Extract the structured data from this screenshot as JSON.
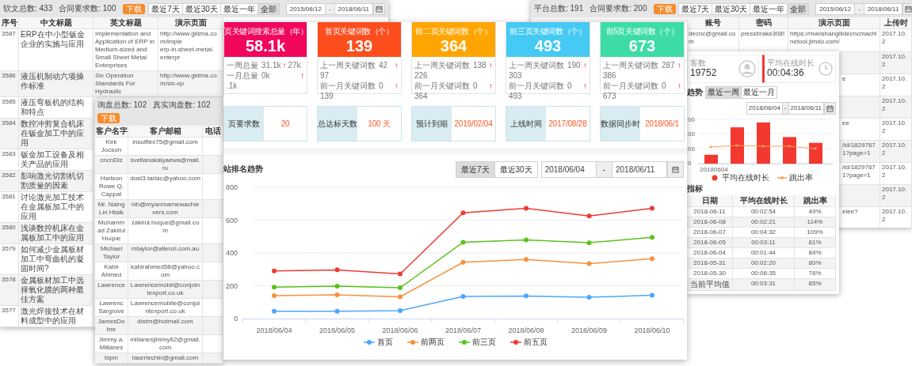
{
  "left_window": {
    "stats": [
      "软文总数: 433",
      "合同要求数: 100"
    ],
    "download": "下载",
    "ranges": [
      {
        "label": "最近7天",
        "selected": false
      },
      {
        "label": "最近30天",
        "selected": false
      },
      {
        "label": "最近一年",
        "selected": false
      },
      {
        "label": "全部",
        "selected": true
      }
    ],
    "date_from": "2015/06/12",
    "date_sep": "-",
    "date_to": "2018/06/11",
    "columns": [
      "序号",
      "中文标题",
      "英文标题",
      "演示页面"
    ],
    "rows": [
      {
        "id": "3587",
        "title_cn": "ERP在中小型钣金企业的实施与应用",
        "title_en": "Implementation and Application of ERP in Medium-sized and Small Sheet Metal Enterprises",
        "url_lines": [
          "http://www.gldma.com/imple",
          "erp-in-sheet-metal-enterpr"
        ]
      },
      {
        "id": "3586",
        "title_cn": "液压机制动六项操作标准",
        "title_en": "Six Operation Standards For Hydraulic",
        "url_lines": [
          "http://www.gldma.com/six-op"
        ]
      },
      {
        "id": "3585",
        "title_cn": "液压弯板机的结构和特点"
      },
      {
        "id": "3584",
        "title_cn": "数控冲剪复合机床在钣金加工中的应用"
      },
      {
        "id": "3583",
        "title_cn": "钣金加工设备及相关产品的应用"
      },
      {
        "id": "3582",
        "title_cn": "影响激光切割机切割质量的因素"
      },
      {
        "id": "3581",
        "title_cn": "讨论激光加工技术在金属板加工中的应用"
      },
      {
        "id": "3580",
        "title_cn": "浅谈数控机床在金属板加工中的应用"
      },
      {
        "id": "3579",
        "title_cn": "如何减少金属板材加工中弯曲机的凝固时间?"
      },
      {
        "id": "3578",
        "title_cn": "金属板材加工中选择氧化膜的两种最佳方案"
      },
      {
        "id": "3577",
        "title_cn": "激光焊接技术在材料成型中的应用"
      }
    ]
  },
  "customer_window": {
    "stats": [
      "询盘总数: 102",
      "真实询盘数: 102"
    ],
    "download": "下载",
    "columns": [
      "客户名字",
      "客户邮箱",
      "电话"
    ],
    "rows": [
      {
        "name": "Kirk Jocson",
        "email": "insulflex75@gmail.com"
      },
      {
        "name": "cncnDiz",
        "email": "svetlanakalyaewa@mail.ru"
      },
      {
        "name": "Harlson Rowe Q. Cappal",
        "email": "dost3.tarlac@yahoo.com"
      },
      {
        "name": "Mr. Naing Lin Htaik",
        "email": "nlh@myanmarnewachievers.com"
      },
      {
        "name": "Muhammad Zakirul Huque",
        "email": "zakirul.huque@gmail.com"
      },
      {
        "name": "Michael Taylor",
        "email": "mtaylor@allenzi.com.au"
      },
      {
        "name": "Kabir Ahmed",
        "email": "kabirahmed58@yahoo.com"
      },
      {
        "name": "Lawrence",
        "email": "Lawrencemobil@conjointexport.co.uk"
      },
      {
        "name": "Lawrenc Sargrove",
        "email": "Lawrencemobile@conjointexport.co.uk"
      },
      {
        "name": "JamesDobre",
        "email": "distm@hotmail.com"
      },
      {
        "name": "Jimmy a. Millanes",
        "email": "millanesjimmy62@gmail.com"
      },
      {
        "name": "bipin",
        "email": "lasertechin@gmail.com"
      }
    ]
  },
  "right_window": {
    "stats": [
      "平台总数: 191",
      "合同要求数: 200"
    ],
    "download": "下载",
    "ranges": [
      {
        "label": "最近7天",
        "selected": false
      },
      {
        "label": "最近30天",
        "selected": false
      },
      {
        "label": "最近一年",
        "selected": false
      },
      {
        "label": "全部",
        "selected": true
      }
    ],
    "date_from": "2015/06/12",
    "date_sep": "-",
    "date_to": "2018/06/11",
    "columns": [
      "账号",
      "密码",
      "演示页面",
      "上传时"
    ],
    "rows": [
      {
        "account": "decnc@gmail.com",
        "password": "pressbrake308!",
        "page": "https://manshangilidecncmachinetool.jimdo.com/",
        "time": "2017.10.2"
      },
      {
        "time": "2017.10.2"
      },
      {
        "page": "e",
        "time": "2017.10.2"
      },
      {
        "time": "2017.10.2"
      },
      {
        "page": "ee",
        "time": "2017.10.2"
      },
      {
        "page": "/id/18297671?page=1",
        "time": "2017.10.2"
      },
      {
        "page": "/id/18297671?page=1",
        "time": "2017.10.2"
      },
      {
        "time": "2017.10.2"
      },
      {
        "page": "elee?",
        "time": "2017.10.2"
      }
    ]
  },
  "analytics": {
    "stats": [
      {
        "kind": "visitors",
        "label": "客数",
        "value": "19752"
      },
      {
        "kind": "duration",
        "label": "平均在线时长",
        "value": "00:04:36"
      }
    ],
    "title": "趋势",
    "ranges": [
      {
        "label": "最近一周",
        "selected": true
      },
      {
        "label": "最近一月",
        "selected": false
      }
    ],
    "date_from": "2018/06/04",
    "date_sep": "-",
    "date_to": "2018/06/11",
    "axis_ticks": [
      "00",
      "00",
      "00",
      "0"
    ],
    "x_label": "20180604",
    "legend": [
      {
        "kind": "dot",
        "label": "平均在线时长",
        "color": "#f3392f"
      },
      {
        "kind": "line",
        "label": "跳出率",
        "color": "#f7a35c"
      }
    ],
    "table_title": "指标",
    "columns": [
      "日期",
      "平均在线时长",
      "跳出率"
    ],
    "rows": [
      [
        "2018-06-11",
        "00:02:54",
        "49%"
      ],
      [
        "2018-06-08",
        "00:02:21",
        "114%"
      ],
      [
        "2018-06-07",
        "00:04:32",
        "109%"
      ],
      [
        "2018-06-05",
        "00:03:11",
        "81%"
      ],
      [
        "2018-06-04",
        "00:01:44",
        "84%"
      ],
      [
        "2018-05-31",
        "00:02:20",
        "80%"
      ],
      [
        "2018-05-30",
        "00:08:35",
        "78%"
      ],
      [
        "当前平均值",
        "00:03:31",
        "85%"
      ]
    ]
  },
  "dashboard": {
    "cards": [
      {
        "title": "页关键词搜索总量（年）",
        "value": "58.1k",
        "color": "#f0065b",
        "stats": [
          {
            "label": "一周总量",
            "value": "31.1k",
            "arrow": "↑",
            "extra": "27k",
            "extra_wraps": false
          },
          {
            "label": "一月总量",
            "value": "0k",
            "arrow": "↑",
            "extra": ".1k",
            "extra_wraps": true
          }
        ]
      },
      {
        "title": "首页关键词数（个）",
        "value": "139",
        "color": "#fe4e1e",
        "stats": [
          {
            "label": "上一周关键词数",
            "value": "42",
            "arrow": "↑",
            "extra": "97",
            "extra_wraps": true
          },
          {
            "label": "前一月关键词数",
            "value": "0",
            "arrow": "↑",
            "extra": "139",
            "extra_wraps": true
          }
        ]
      },
      {
        "title": "前二页关键词数（个）",
        "value": "364",
        "color": "#ffa502",
        "stats": [
          {
            "label": "上一周关键词数",
            "value": "138",
            "arrow": "↑",
            "extra": "226",
            "extra_wraps": true
          },
          {
            "label": "前一月关键词数",
            "value": "0",
            "arrow": "↑",
            "extra": "364",
            "extra_wraps": true
          }
        ]
      },
      {
        "title": "前三页关键词数（个）",
        "value": "493",
        "color": "#45caf3",
        "stats": [
          {
            "label": "上一周关键词数",
            "value": "190",
            "arrow": "↑",
            "extra": "303",
            "extra_wraps": true
          },
          {
            "label": "前一月关键词数",
            "value": "0",
            "arrow": "↑",
            "extra": "493",
            "extra_wraps": true
          }
        ]
      },
      {
        "title": "前5页关键词数（个）",
        "value": "673",
        "color": "#3ddca7",
        "stats": [
          {
            "label": "上一周关键词数",
            "value": "287",
            "arrow": "↑",
            "extra": "386",
            "extra_wraps": true
          },
          {
            "label": "前一月关键词数",
            "value": "0",
            "arrow": "↑",
            "extra": "673",
            "extra_wraps": true
          }
        ]
      }
    ],
    "info": [
      {
        "label": "页要求数",
        "value": "20"
      },
      {
        "label": "总达标天数",
        "value": "100 天"
      },
      {
        "label": "预计到期",
        "value": "2019/02/04"
      },
      {
        "label": "上线时间",
        "value": "2017/08/28"
      },
      {
        "label": "数据同步时",
        "value": "2018/06/1"
      }
    ],
    "trend": {
      "title": "站排名趋势",
      "ranges": [
        {
          "label": "最近7天",
          "selected": true
        },
        {
          "label": "最近30天",
          "selected": false
        }
      ],
      "date_from": "2018/06/04",
      "date_sep": "-",
      "date_to": "2018/06/11",
      "chart_data": {
        "type": "line",
        "categories": [
          "2018/06/04",
          "2018/06/05",
          "2018/06/06",
          "2018/06/07",
          "2018/06/08",
          "2018/06/09",
          "2018/06/10"
        ],
        "ylim": [
          0,
          800
        ],
        "yticks": [
          0,
          200,
          400,
          600,
          800
        ],
        "grid": true,
        "legend": "bottom",
        "series": [
          {
            "name": "首页",
            "color": "#4da6ff",
            "marker": "circle",
            "values": [
              45,
              45,
              48,
              135,
              138,
              130,
              142
            ]
          },
          {
            "name": "前两页",
            "color": "#f7913d",
            "marker": "circle",
            "values": [
              140,
              145,
              132,
              343,
              360,
              335,
              365
            ]
          },
          {
            "name": "前三页",
            "color": "#5ac31b",
            "marker": "circle",
            "values": [
              192,
              198,
              188,
              465,
              480,
              462,
              495
            ]
          },
          {
            "name": "前五页",
            "color": "#ef3a32",
            "marker": "circle",
            "values": [
              290,
              297,
              272,
              645,
              672,
              625,
              672
            ]
          }
        ]
      }
    }
  }
}
